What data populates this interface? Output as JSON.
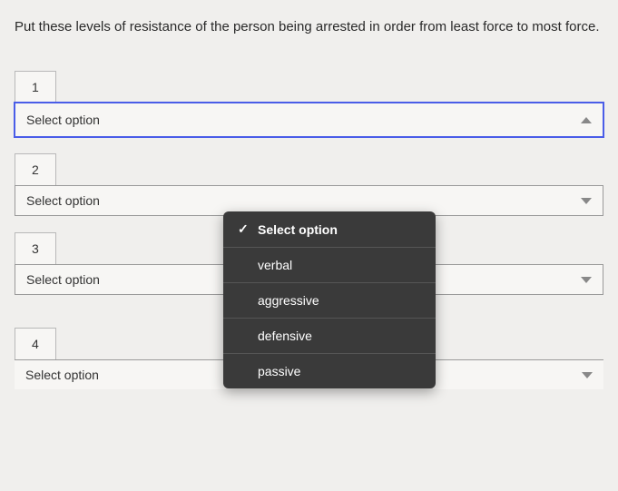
{
  "question": "Put these levels of resistance of the person being arrested in order from least force to most force.",
  "items": [
    {
      "number": "1",
      "placeholder": "Select option",
      "open": true
    },
    {
      "number": "2",
      "placeholder": "Select option",
      "open": false
    },
    {
      "number": "3",
      "placeholder": "Select option",
      "open": false
    },
    {
      "number": "4",
      "placeholder": "Select option",
      "open": false
    }
  ],
  "dropdown": {
    "header": "Select option",
    "check": "✓",
    "options": [
      "verbal",
      "aggressive",
      "defensive",
      "passive"
    ]
  }
}
